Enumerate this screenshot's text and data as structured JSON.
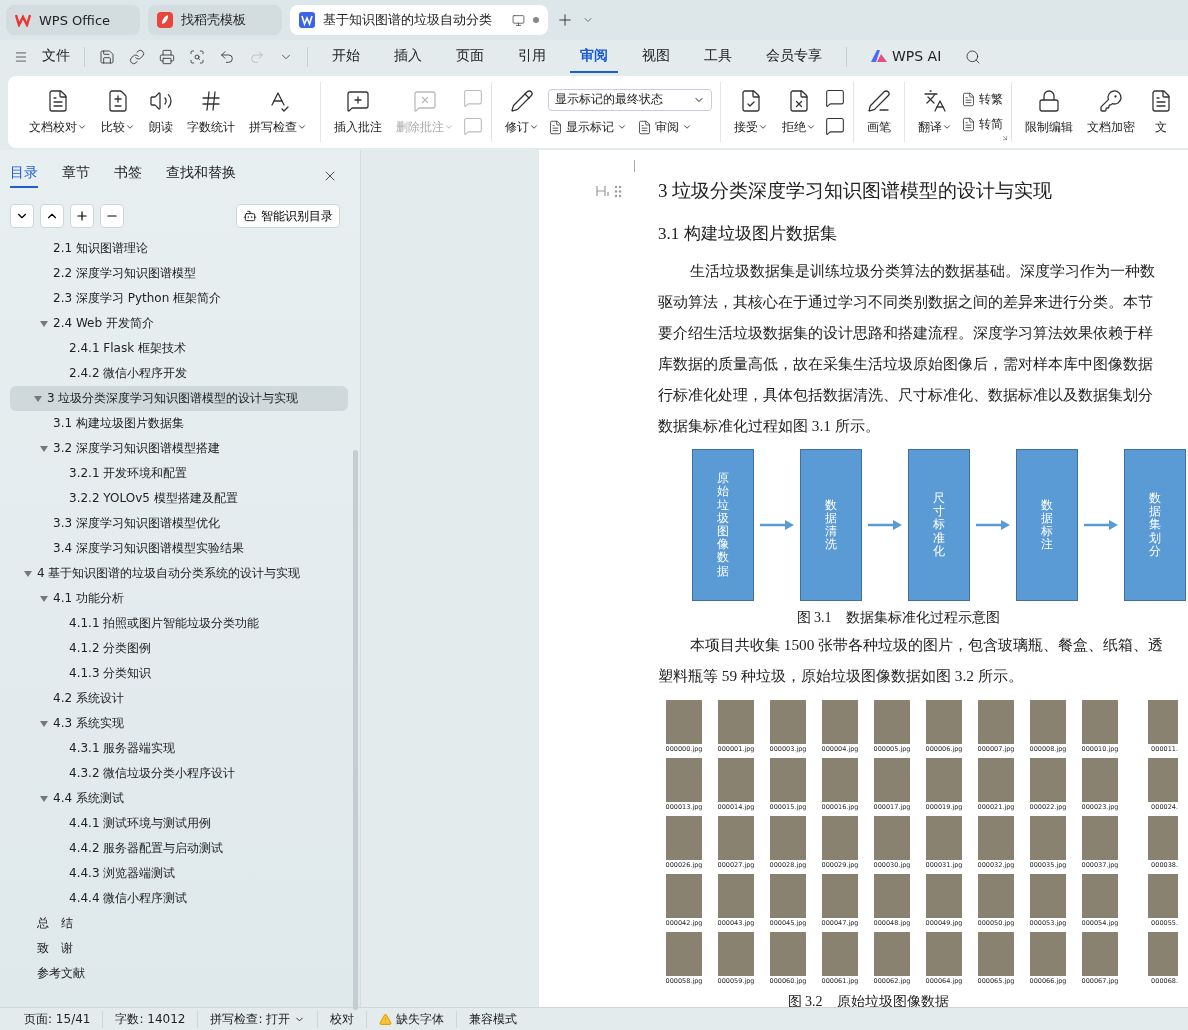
{
  "browser_tabs": [
    {
      "title": "WPS Office",
      "selected": false
    },
    {
      "title": "找稻壳模板",
      "selected": false
    },
    {
      "title": "基于知识图谱的垃圾自动分类",
      "selected": true
    }
  ],
  "menu": {
    "file": "文件",
    "tabs": [
      {
        "label": "开始",
        "selected": false
      },
      {
        "label": "插入",
        "selected": false
      },
      {
        "label": "页面",
        "selected": false
      },
      {
        "label": "引用",
        "selected": false
      },
      {
        "label": "审阅",
        "selected": true
      },
      {
        "label": "视图",
        "selected": false
      },
      {
        "label": "工具",
        "selected": false
      },
      {
        "label": "会员专享",
        "selected": false
      }
    ],
    "ai": "WPS AI"
  },
  "ribbon": {
    "groups": [
      {
        "items": [
          {
            "kind": "large",
            "label": "文档校对",
            "dropdown": true,
            "disabled": false
          },
          {
            "kind": "large",
            "label": "比较",
            "dropdown": true,
            "disabled": false
          },
          {
            "kind": "large",
            "label": "朗读",
            "dropdown": false,
            "disabled": false
          },
          {
            "kind": "large",
            "label": "字数统计",
            "dropdown": false,
            "disabled": false
          },
          {
            "kind": "large",
            "label": "拼写检查",
            "dropdown": true,
            "disabled": false
          }
        ]
      },
      {
        "items": [
          {
            "kind": "large",
            "label": "插入批注",
            "dropdown": false,
            "disabled": false
          },
          {
            "kind": "large",
            "label": "删除批注",
            "dropdown": true,
            "disabled": true
          },
          {
            "kind": "column",
            "items": [
              {
                "kind": "icon",
                "disabled": true
              },
              {
                "kind": "icon",
                "disabled": true
              }
            ]
          }
        ]
      },
      {
        "items": [
          {
            "kind": "large",
            "label": "修订",
            "dropdown": true,
            "disabled": false
          },
          {
            "kind": "column",
            "items": [
              {
                "kind": "select",
                "value": "显示标记的最终状态"
              },
              {
                "kind": "row",
                "items": [
                  {
                    "kind": "small",
                    "label": "显示标记",
                    "dropdown": true
                  },
                  {
                    "kind": "small",
                    "label": "审阅",
                    "dropdown": true
                  }
                ]
              }
            ]
          }
        ]
      },
      {
        "items": [
          {
            "kind": "large",
            "label": "接受",
            "dropdown": true,
            "disabled": false
          },
          {
            "kind": "large",
            "label": "拒绝",
            "dropdown": true,
            "disabled": false
          },
          {
            "kind": "column",
            "items": [
              {
                "kind": "icon",
                "disabled": false
              },
              {
                "kind": "icon",
                "disabled": false
              }
            ]
          }
        ]
      },
      {
        "items": [
          {
            "kind": "large",
            "label": "画笔",
            "dropdown": false,
            "disabled": false
          }
        ]
      },
      {
        "items": [
          {
            "kind": "large",
            "label": "翻译",
            "dropdown": true,
            "disabled": false
          },
          {
            "kind": "column",
            "items": [
              {
                "kind": "small",
                "label": "转繁",
                "dropdown": false
              },
              {
                "kind": "small",
                "label": "转简",
                "dropdown": false
              }
            ]
          }
        ]
      },
      {
        "items": [
          {
            "kind": "large",
            "label": "限制编辑",
            "dropdown": false,
            "disabled": false
          },
          {
            "kind": "large",
            "label": "文档加密",
            "dropdown": false,
            "disabled": false
          },
          {
            "kind": "large",
            "label": "文",
            "dropdown": false,
            "disabled": false
          }
        ]
      }
    ]
  },
  "sidebar": {
    "tabs": [
      {
        "label": "目录",
        "selected": true
      },
      {
        "label": "章节",
        "selected": false
      },
      {
        "label": "书签",
        "selected": false
      },
      {
        "label": "查找和替换",
        "selected": false
      }
    ],
    "smart_button": "智能识别目录",
    "toc": [
      {
        "children": [
          {
            "label": "2.1  知识图谱理论"
          },
          {
            "label": "2.2  深度学习知识图谱模型"
          },
          {
            "label": "2.3  深度学习 Python 框架简介"
          },
          {
            "label": "2.4 Web 开发简介",
            "expanded": true,
            "children": [
              {
                "label": "2.4.1 Flask 框架技术"
              },
              {
                "label": "2.4.2  微信小程序开发"
              }
            ]
          }
        ]
      },
      {
        "label": "3  垃圾分类深度学习知识图谱模型的设计与实现",
        "selected": true,
        "expanded": true,
        "children": [
          {
            "label": "3.1  构建垃圾图片数据集"
          },
          {
            "label": "3.2  深度学习知识图谱模型搭建",
            "expanded": true,
            "children": [
              {
                "label": "3.2.1  开发环境和配置"
              },
              {
                "label": "3.2.2 YOLOv5 模型搭建及配置"
              }
            ]
          },
          {
            "label": "3.3  深度学习知识图谱模型优化"
          },
          {
            "label": "3.4  深度学习知识图谱模型实验结果"
          }
        ]
      },
      {
        "label": "4  基于知识图谱的垃圾自动分类系统的设计与实现",
        "expanded": true,
        "children": [
          {
            "label": "4.1  功能分析",
            "expanded": true,
            "children": [
              {
                "label": "4.1.1  拍照或图片智能垃圾分类功能"
              },
              {
                "label": "4.1.2  分类图例"
              },
              {
                "label": "4.1.3  分类知识"
              }
            ]
          },
          {
            "label": "4.2  系统设计"
          },
          {
            "label": "4.3  系统实现",
            "expanded": true,
            "children": [
              {
                "label": "4.3.1  服务器端实现"
              },
              {
                "label": "4.3.2  微信垃圾分类小程序设计"
              }
            ]
          },
          {
            "label": "4.4  系统测试",
            "expanded": true,
            "children": [
              {
                "label": "4.4.1  测试环境与测试用例"
              },
              {
                "label": "4.4.2  服务器配置与启动测试"
              },
              {
                "label": "4.4.3  浏览器端测试"
              },
              {
                "label": "4.4.4  微信小程序测试"
              }
            ]
          }
        ]
      },
      {
        "label": "总　结"
      },
      {
        "label": "致　谢"
      },
      {
        "label": "参考文献"
      }
    ]
  },
  "document": {
    "heading": "3  垃圾分类深度学习知识图谱模型的设计与实现",
    "subheading": "3.1  构建垃圾图片数据集",
    "paragraph_1": [
      "生活垃圾数据集是训练垃圾分类算法的数据基础。深度学习作为一种数",
      "驱动算法，其核心在于通过学习不同类别数据之间的差异来进行分类。本节",
      "要介绍生活垃圾数据集的设计思路和搭建流程。深度学习算法效果依赖于样",
      "库数据的质量高低，故在采集生活垃圾原始图像后，需对样本库中图像数据",
      "行标准化处理，具体包括数据清洗、尺寸标准化、数据标准以及数据集划分",
      "数据集标准化过程如图 3.1 所示。"
    ],
    "flow_steps": [
      "原始垃圾图像数据",
      "数据清洗",
      "尺寸标准化",
      "数据标注",
      "数据集划分"
    ],
    "figure_3_1_caption": "图 3.1　数据集标准化过程示意图",
    "paragraph_2": [
      "本项目共收集 1500 张带各种垃圾的图片，包含玻璃瓶、餐盒、纸箱、透",
      "塑料瓶等 59 种垃圾，原始垃圾图像数据如图 3.2 所示。"
    ],
    "image_files": [
      [
        "000000.jpg",
        "000001.jpg",
        "000003.jpg",
        "000004.jpg",
        "000005.jpg",
        "000006.jpg",
        "000007.jpg",
        "000008.jpg",
        "000010.jpg",
        "000011."
      ],
      [
        "000013.jpg",
        "000014.jpg",
        "000015.jpg",
        "000016.jpg",
        "000017.jpg",
        "000019.jpg",
        "000021.jpg",
        "000022.jpg",
        "000023.jpg",
        "000024."
      ],
      [
        "000026.jpg",
        "000027.jpg",
        "000028.jpg",
        "000029.jpg",
        "000030.jpg",
        "000031.jpg",
        "000032.jpg",
        "000035.jpg",
        "000037.jpg",
        "000038."
      ],
      [
        "000042.jpg",
        "000043.jpg",
        "000045.jpg",
        "000047.jpg",
        "000048.jpg",
        "000049.jpg",
        "000050.jpg",
        "000053.jpg",
        "000054.jpg",
        "000055."
      ],
      [
        "000058.jpg",
        "000059.jpg",
        "000060.jpg",
        "000061.jpg",
        "000062.jpg",
        "000064.jpg",
        "000065.jpg",
        "000066.jpg",
        "000067.jpg",
        "000068."
      ]
    ],
    "figure_3_2_caption": "图 3.2　原始垃圾图像数据"
  },
  "status_bar": [
    {
      "kind": "text",
      "label": "页面: 15/41"
    },
    {
      "kind": "text",
      "label": "字数: 14012"
    },
    {
      "kind": "dropdown",
      "label": "拼写检查: 打开"
    },
    {
      "kind": "text",
      "label": "校对"
    },
    {
      "kind": "warning",
      "label": "缺失字体"
    },
    {
      "kind": "text",
      "label": "兼容模式"
    }
  ]
}
